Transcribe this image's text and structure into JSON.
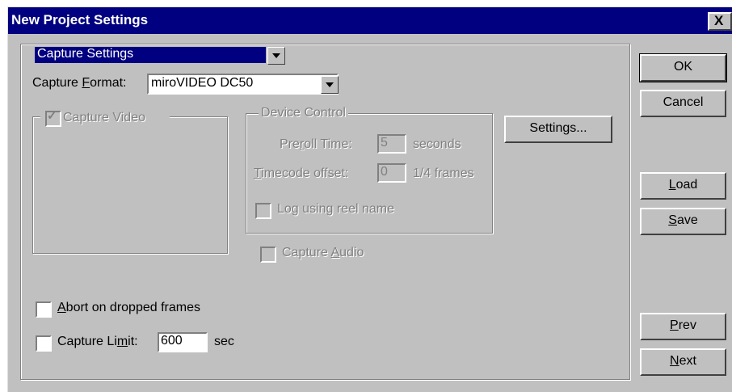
{
  "window": {
    "title": "New Project Settings",
    "close_glyph": "X"
  },
  "category_select": {
    "value": "Capture Settings"
  },
  "capture_format": {
    "label_pre": "Capture ",
    "label_accel": "F",
    "label_post": "ormat:",
    "value": "miroVIDEO DC50"
  },
  "capture_video": {
    "label": "Capture Video",
    "checked": true,
    "enabled": false
  },
  "device_control": {
    "title": "Device Control",
    "preroll": {
      "label_pre": "Pre",
      "label_accel": "r",
      "label_post": "oll Time:",
      "value": "5",
      "unit": "seconds"
    },
    "timecode": {
      "label_accel": "T",
      "label_post": "imecode offset:",
      "value": "0",
      "unit": "1/4 frames"
    },
    "log_reel": {
      "label_pre": "Lo",
      "label_accel": "g",
      "label_post": " using reel name",
      "checked": false
    }
  },
  "settings_button": {
    "label": "Settings..."
  },
  "capture_audio": {
    "label_pre": "Capture ",
    "label_accel": "A",
    "label_post": "udio",
    "checked": false,
    "enabled": false
  },
  "abort_dropped": {
    "label_accel": "A",
    "label_post": "bort on dropped frames",
    "checked": false
  },
  "capture_limit": {
    "label_pre": "Capture Li",
    "label_accel": "m",
    "label_post": "it:",
    "value": "600",
    "unit": "sec",
    "checked": false
  },
  "buttons": {
    "ok": "OK",
    "cancel": "Cancel",
    "load_accel": "L",
    "load_post": "oad",
    "save_accel": "S",
    "save_post": "ave",
    "prev_accel": "P",
    "prev_post": "rev",
    "next_accel": "N",
    "next_post": "ext"
  }
}
